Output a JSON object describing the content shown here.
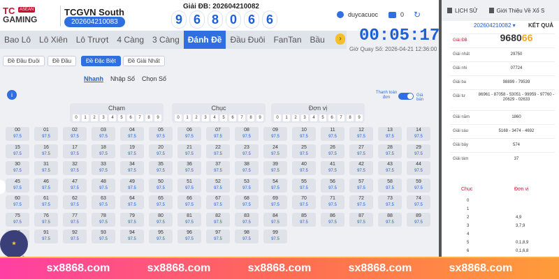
{
  "header": {
    "brand": "TC",
    "brand_badge": "ASEAN",
    "brand_sub": "GAMING",
    "region": "TCGVN South",
    "draw_code": "202604210083",
    "prize_label": "Giải ĐB: 202604210082",
    "digits": [
      "9",
      "6",
      "8",
      "0",
      "6",
      "6"
    ],
    "username": "duycacuoc",
    "balance": "0"
  },
  "tabs": [
    "Bao Lô",
    "Lô Xiên",
    "Lô Trượt",
    "4 Càng",
    "3 Càng",
    "Đánh Đề",
    "Đầu Đuôi",
    "FanTan",
    "Bầu"
  ],
  "active_tab": "Đánh Đề",
  "timer": {
    "value": "00:05:17",
    "label": "Giờ Quay Số: 2026-04-21 12:36:00"
  },
  "subtabs": [
    "Đề Đầu Đuôi",
    "Đề Đầu",
    "Đề Đặc Biệt",
    "Đề Giải Nhất"
  ],
  "modes": [
    "Nhanh",
    "Nhập Số",
    "Chọn Số"
  ],
  "toggle": {
    "left": "Thanh toán đơn",
    "right": "Giá bán"
  },
  "groups": [
    {
      "title": "Chạm",
      "digits": [
        "0",
        "1",
        "2",
        "3",
        "4",
        "5",
        "6",
        "7",
        "8",
        "9"
      ]
    },
    {
      "title": "Chục",
      "digits": [
        "0",
        "1",
        "2",
        "3",
        "4",
        "5",
        "6",
        "7",
        "8",
        "9"
      ]
    },
    {
      "title": "Đơn vị",
      "digits": [
        "0",
        "1",
        "2",
        "3",
        "4",
        "5",
        "6",
        "7",
        "8",
        "9"
      ]
    }
  ],
  "odds": "97.5",
  "numbers": [
    "00",
    "01",
    "02",
    "03",
    "04",
    "05",
    "06",
    "07",
    "08",
    "09",
    "10",
    "11",
    "12",
    "13",
    "14",
    "15",
    "16",
    "17",
    "18",
    "19",
    "20",
    "21",
    "22",
    "23",
    "24",
    "25",
    "26",
    "27",
    "28",
    "29",
    "30",
    "31",
    "32",
    "33",
    "34",
    "35",
    "36",
    "37",
    "38",
    "39",
    "40",
    "41",
    "42",
    "43",
    "44",
    "45",
    "46",
    "47",
    "48",
    "49",
    "50",
    "51",
    "52",
    "53",
    "54",
    "55",
    "56",
    "57",
    "58",
    "59",
    "60",
    "61",
    "62",
    "63",
    "64",
    "65",
    "66",
    "67",
    "68",
    "69",
    "70",
    "71",
    "72",
    "73",
    "74",
    "75",
    "76",
    "77",
    "78",
    "79",
    "80",
    "81",
    "82",
    "83",
    "84",
    "85",
    "86",
    "87",
    "88",
    "89",
    "90",
    "91",
    "92",
    "93",
    "94",
    "95",
    "96",
    "97",
    "98",
    "99"
  ],
  "right_panel": {
    "tab_history": "LỊCH SỬ",
    "tab_intro": "Giới Thiệu Về Xổ S",
    "draw_select": "202604210082",
    "result_label": "KẾT QUẢ",
    "results": [
      {
        "label": "Giải ĐB",
        "head": "9680",
        "tail": "66"
      },
      {
        "label": "Giải nhất",
        "value": "29750"
      },
      {
        "label": "Giải nhì",
        "value": "07724"
      },
      {
        "label": "Giải ba",
        "value": "98899 - 79539"
      },
      {
        "label": "Giải tư",
        "value": "86961 - 87058 - 53051 - 99959 - 97760 - 20629 - 02633"
      },
      {
        "label": "Giải năm",
        "value": "1860"
      },
      {
        "label": "Giải sáu",
        "value": "5168 - 3474 - 4692"
      },
      {
        "label": "Giải bảy",
        "value": "574"
      },
      {
        "label": "Giải tám",
        "value": "37"
      }
    ],
    "head_chuc": "Chục",
    "head_donvi": "Đơn vị",
    "heads": [
      {
        "c": "0",
        "d": ""
      },
      {
        "c": "1",
        "d": ""
      },
      {
        "c": "2",
        "d": "4,9"
      },
      {
        "c": "3",
        "d": "3,7,9"
      },
      {
        "c": "4",
        "d": ""
      },
      {
        "c": "5",
        "d": "0,1,8,9"
      },
      {
        "c": "6",
        "d": "0,1,6,8"
      }
    ]
  },
  "mascot_text": "ĐỀ",
  "banner": [
    "sx8868.com",
    "sx8868.com",
    "sx8868.com",
    "sx8868.com",
    "sx8868.com"
  ]
}
